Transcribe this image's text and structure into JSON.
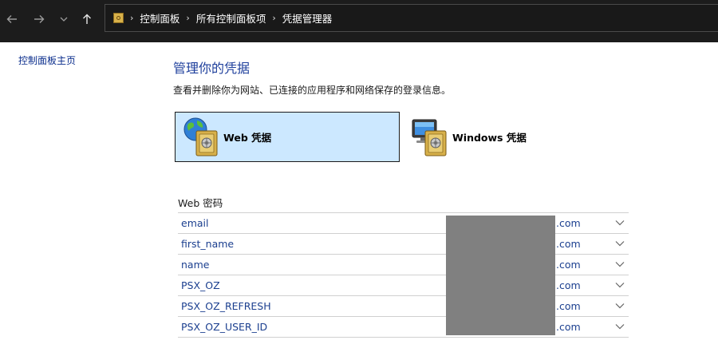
{
  "breadcrumb": {
    "items": [
      "控制面板",
      "所有控制面板项",
      "凭据管理器"
    ],
    "separator": "›"
  },
  "sidebar": {
    "home_link": "控制面板主页"
  },
  "main": {
    "title": "管理你的凭据",
    "subtitle": "查看并删除你为网站、已连接的应用程序和网络保存的登录信息。",
    "tiles": [
      {
        "label": "Web 凭据",
        "selected": true,
        "icon": "globe-vault-icon"
      },
      {
        "label": "Windows 凭据",
        "selected": false,
        "icon": "monitor-vault-icon"
      }
    ],
    "section_title": "Web 密码",
    "credentials": [
      {
        "name": "email",
        "address": ".com"
      },
      {
        "name": "first_name",
        "address": ".com"
      },
      {
        "name": "name",
        "address": ".com"
      },
      {
        "name": "PSX_OZ",
        "address": ".com"
      },
      {
        "name": "PSX_OZ_REFRESH",
        "address": ".com"
      },
      {
        "name": "PSX_OZ_USER_ID",
        "address": ".com"
      }
    ]
  },
  "colors": {
    "topbar": "#1c1c1c",
    "selected_tile": "#cce8ff",
    "link": "#1b3f8f",
    "title": "#1e3f9c",
    "redaction": "#808080"
  }
}
